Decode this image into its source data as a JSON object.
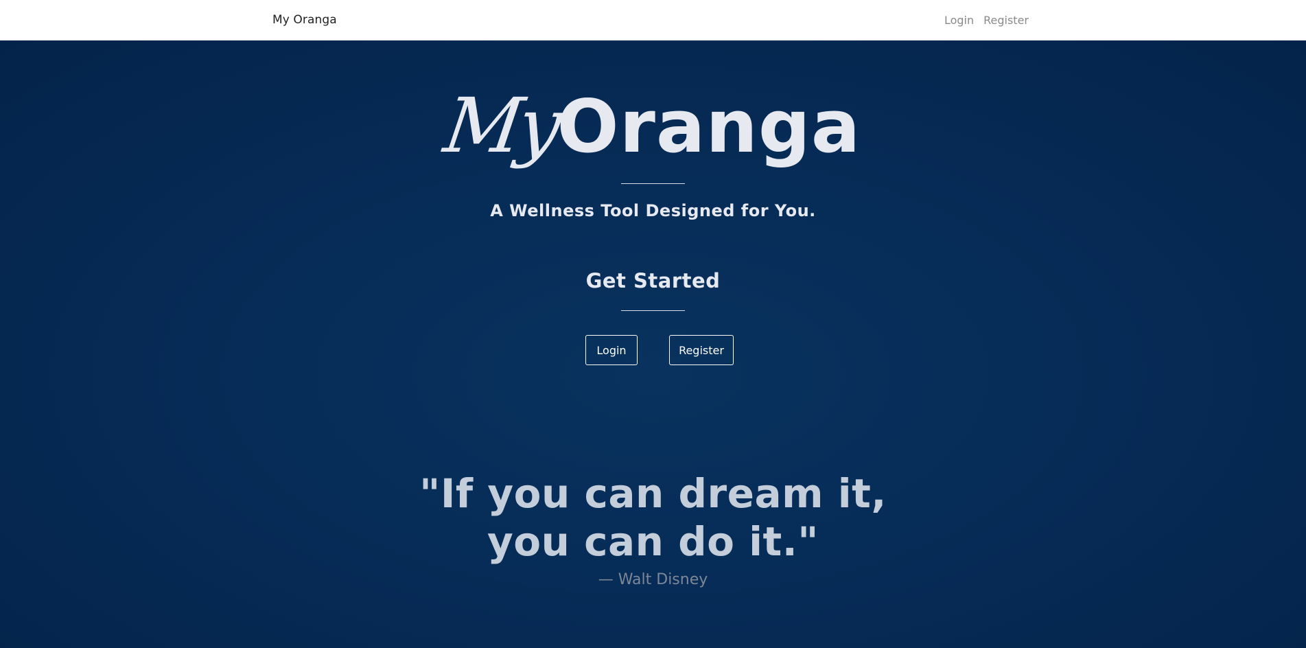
{
  "navbar": {
    "brand": "My Oranga",
    "links": [
      "Login",
      "Register"
    ]
  },
  "hero": {
    "logo_script": "My",
    "logo_main": "Oranga",
    "tagline": "A Wellness Tool Designed for You.",
    "get_started": "Get Started",
    "buttons": {
      "login": "Login",
      "register": "Register"
    },
    "quote_lines": [
      "\"If you can dream it,",
      "you can do it.\""
    ],
    "attribution": "— Walt Disney"
  },
  "colors": {
    "navbar_bg": "#ffffff",
    "hero_bg": "#062c57",
    "hero_text": "#e6e9ef",
    "quote_text": "#c4cdda",
    "attribution_text": "#7d8796",
    "nav_link": "#8a8a8a"
  }
}
